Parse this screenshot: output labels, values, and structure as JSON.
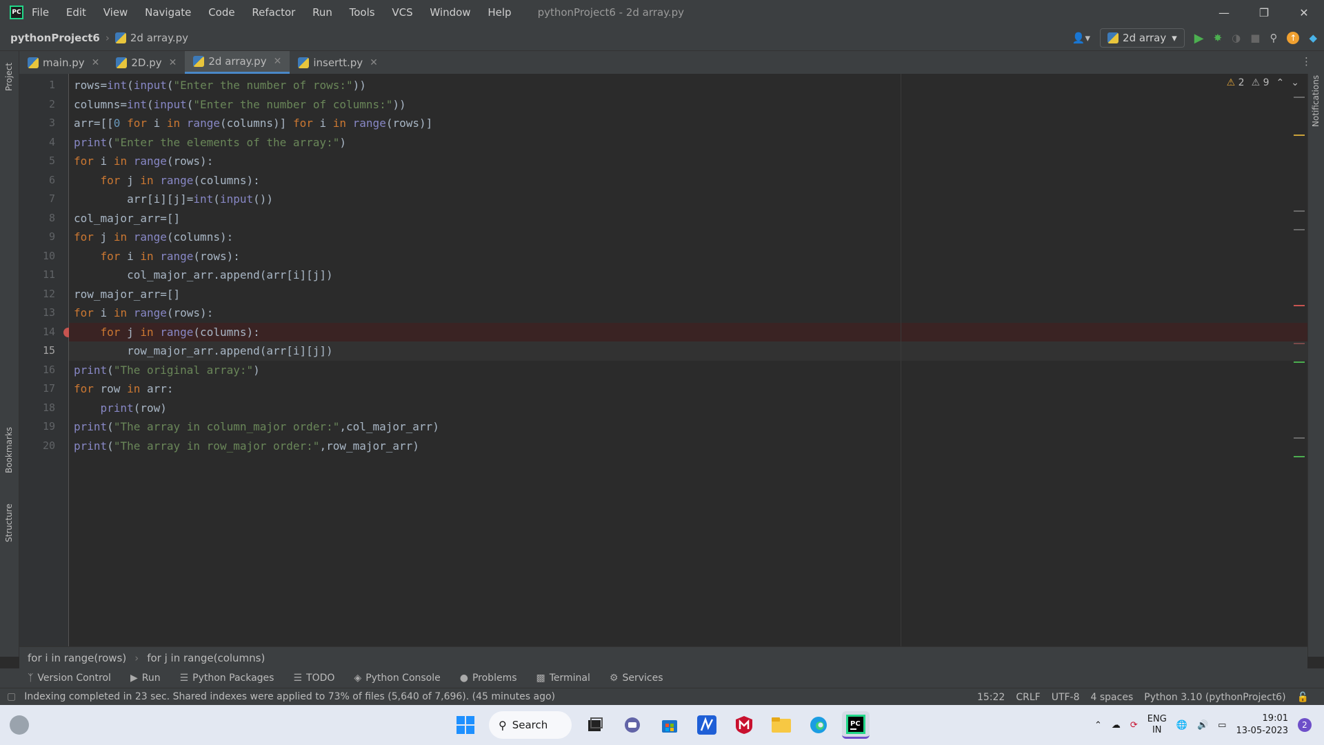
{
  "window": {
    "title": "pythonProject6 - 2d array.py",
    "menu": [
      "File",
      "Edit",
      "View",
      "Navigate",
      "Code",
      "Refactor",
      "Run",
      "Tools",
      "VCS",
      "Window",
      "Help"
    ]
  },
  "nav": {
    "project": "pythonProject6",
    "file": "2d array.py",
    "run_config": "2d array"
  },
  "tabs": [
    {
      "label": "main.py"
    },
    {
      "label": "2D.py"
    },
    {
      "label": "2d array.py",
      "active": true
    },
    {
      "label": "insertt.py"
    }
  ],
  "side_labels": {
    "left": [
      "Project",
      "Bookmarks",
      "Structure"
    ],
    "right": [
      "Notifications"
    ]
  },
  "inspections": {
    "warnings_a": "2",
    "warnings_b": "9"
  },
  "code_lines": [
    "rows=int(input(\"Enter the number of rows:\"))",
    "columns=int(input(\"Enter the number of columns:\"))",
    "arr=[[0 for i in range(columns)] for i in range(rows)]",
    "print(\"Enter the elements of the array:\")",
    "for i in range(rows):",
    "    for j in range(columns):",
    "        arr[i][j]=int(input())",
    "col_major_arr=[]",
    "for j in range(columns):",
    "    for i in range(rows):",
    "        col_major_arr.append(arr[i][j])",
    "row_major_arr=[]",
    "for i in range(rows):",
    "    for j in range(columns):",
    "        row_major_arr.append(arr[i][j])",
    "print(\"The original array:\")",
    "for row in arr:",
    "    print(row)",
    "print(\"The array in column_major order:\",col_major_arr)",
    "print(\"The array in row_major order:\",row_major_arr)"
  ],
  "line_numbers": [
    "1",
    "2",
    "3",
    "4",
    "5",
    "6",
    "7",
    "8",
    "9",
    "10",
    "11",
    "12",
    "13",
    "14",
    "15",
    "16",
    "17",
    "18",
    "19",
    "20"
  ],
  "breakpoint_line": 14,
  "current_line": 15,
  "breadcrumb": [
    "for i in range(rows)",
    "for j in range(columns)"
  ],
  "tool_windows": [
    "Version Control",
    "Run",
    "Python Packages",
    "TODO",
    "Python Console",
    "Problems",
    "Terminal",
    "Services"
  ],
  "status": {
    "message": "Indexing completed in 23 sec. Shared indexes were applied to 73% of files (5,640 of 7,696). (45 minutes ago)",
    "position": "15:22",
    "line_sep": "CRLF",
    "encoding": "UTF-8",
    "indent": "4 spaces",
    "interpreter": "Python 3.10 (pythonProject6)"
  },
  "taskbar": {
    "search_label": "Search",
    "lang": "ENG",
    "region": "IN",
    "time": "19:01",
    "date": "13-05-2023",
    "notif_count": "2"
  },
  "colors": {
    "accent": "#4a88c7",
    "breakpoint": "#c75450",
    "bg": "#2b2b2b"
  }
}
